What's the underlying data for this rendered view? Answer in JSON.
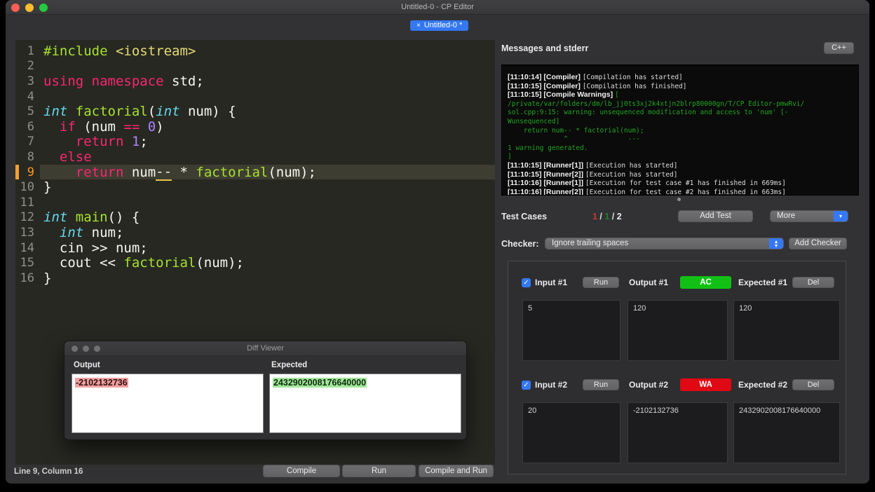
{
  "window": {
    "title": "Untitled-0 - CP Editor"
  },
  "tab": {
    "close_icon": "×",
    "label": "Untitled-0 *"
  },
  "editor": {
    "current_line": 9,
    "status": "Line 9, Column 16",
    "lines": [
      {
        "num": 1,
        "tokens": [
          {
            "t": "#include ",
            "c": "fn"
          },
          {
            "t": "<iostream>",
            "c": "str"
          }
        ]
      },
      {
        "num": 2,
        "tokens": []
      },
      {
        "num": 3,
        "tokens": [
          {
            "t": "using",
            "c": "kw"
          },
          {
            "t": " ",
            "c": "pl"
          },
          {
            "t": "namespace",
            "c": "kw"
          },
          {
            "t": " std;",
            "c": "pl"
          }
        ]
      },
      {
        "num": 4,
        "tokens": []
      },
      {
        "num": 5,
        "tokens": [
          {
            "t": "int",
            "c": "ty"
          },
          {
            "t": " ",
            "c": "pl"
          },
          {
            "t": "factorial",
            "c": "fn"
          },
          {
            "t": "(",
            "c": "pl"
          },
          {
            "t": "int",
            "c": "ty"
          },
          {
            "t": " num) {",
            "c": "pl"
          }
        ]
      },
      {
        "num": 6,
        "tokens": [
          {
            "t": "  ",
            "c": "pl"
          },
          {
            "t": "if",
            "c": "kw"
          },
          {
            "t": " (num ",
            "c": "pl"
          },
          {
            "t": "==",
            "c": "kw"
          },
          {
            "t": " ",
            "c": "pl"
          },
          {
            "t": "0",
            "c": "num"
          },
          {
            "t": ")",
            "c": "pl"
          }
        ]
      },
      {
        "num": 7,
        "tokens": [
          {
            "t": "    ",
            "c": "pl"
          },
          {
            "t": "return",
            "c": "kw"
          },
          {
            "t": " ",
            "c": "pl"
          },
          {
            "t": "1",
            "c": "num"
          },
          {
            "t": ";",
            "c": "pl"
          }
        ]
      },
      {
        "num": 8,
        "tokens": [
          {
            "t": "  ",
            "c": "pl"
          },
          {
            "t": "else",
            "c": "kw"
          }
        ]
      },
      {
        "num": 9,
        "tokens": [
          {
            "t": "    ",
            "c": "pl"
          },
          {
            "t": "return",
            "c": "kw"
          },
          {
            "t": " num",
            "c": "pl"
          },
          {
            "t": "--",
            "c": "ul"
          },
          {
            "t": " * ",
            "c": "pl"
          },
          {
            "t": "factorial",
            "c": "fn"
          },
          {
            "t": "(num);",
            "c": "pl"
          }
        ]
      },
      {
        "num": 10,
        "tokens": [
          {
            "t": "}",
            "c": "pl"
          }
        ]
      },
      {
        "num": 11,
        "tokens": []
      },
      {
        "num": 12,
        "tokens": [
          {
            "t": "int",
            "c": "ty"
          },
          {
            "t": " ",
            "c": "pl"
          },
          {
            "t": "main",
            "c": "fn"
          },
          {
            "t": "() {",
            "c": "pl"
          }
        ]
      },
      {
        "num": 13,
        "tokens": [
          {
            "t": "  ",
            "c": "pl"
          },
          {
            "t": "int",
            "c": "ty"
          },
          {
            "t": " num;",
            "c": "pl"
          }
        ]
      },
      {
        "num": 14,
        "tokens": [
          {
            "t": "  cin >> num;",
            "c": "pl"
          }
        ]
      },
      {
        "num": 15,
        "tokens": [
          {
            "t": "  cout << ",
            "c": "pl"
          },
          {
            "t": "factorial",
            "c": "fn"
          },
          {
            "t": "(num);",
            "c": "pl"
          }
        ]
      },
      {
        "num": 16,
        "tokens": [
          {
            "t": "}",
            "c": "pl"
          }
        ]
      }
    ]
  },
  "actions": {
    "compile": "Compile",
    "run": "Run",
    "compile_and_run": "Compile and Run"
  },
  "messages": {
    "header": "Messages and stderr",
    "language_button": "C++",
    "log": [
      [
        {
          "t": "[11:10:14] [Compiler] ",
          "s": "label"
        },
        {
          "t": "[Compilation has started]",
          "s": "mono"
        }
      ],
      [
        {
          "t": "[11:10:15] [Compiler] ",
          "s": "label"
        },
        {
          "t": "[Compilation has finished]",
          "s": "mono"
        }
      ],
      [
        {
          "t": "[11:10:15] [Compile Warnings] ",
          "s": "label"
        },
        {
          "t": "[",
          "s": "green"
        }
      ],
      [
        {
          "t": "/private/var/folders/dm/lb_jj0ts3xj2k4xtjn2blrp80000gn/T/CP Editor-pmwRvi/",
          "s": "green"
        }
      ],
      [
        {
          "t": "sol.cpp:9:15: warning: unsequenced modification and access to 'num' [-",
          "s": "green"
        }
      ],
      [
        {
          "t": "Wunsequenced]",
          "s": "green"
        }
      ],
      [
        {
          "t": "    return num-- * factorial(num);",
          "s": "green"
        }
      ],
      [
        {
          "t": "              ^               ---",
          "s": "green"
        }
      ],
      [
        {
          "t": "1 warning generated.",
          "s": "green"
        }
      ],
      [
        {
          "t": "]",
          "s": "green"
        }
      ],
      [
        {
          "t": "[11:10:15] [Runner[1]] ",
          "s": "label"
        },
        {
          "t": "[Execution has started]",
          "s": "mono"
        }
      ],
      [
        {
          "t": "[11:10:15] [Runner[2]] ",
          "s": "label"
        },
        {
          "t": "[Execution has started]",
          "s": "mono"
        }
      ],
      [
        {
          "t": "[11:10:16] [Runner[1]] ",
          "s": "label"
        },
        {
          "t": "[Execution for test case #1 has finished in 669ms]",
          "s": "mono"
        }
      ],
      [
        {
          "t": "[11:10:16] [Runner[2]] ",
          "s": "label"
        },
        {
          "t": "[Execution for test case #2 has finished in 663ms]",
          "s": "mono"
        }
      ]
    ]
  },
  "test_cases_bar": {
    "label": "Test Cases",
    "counts": [
      {
        "t": "1",
        "c": "#c23a33"
      },
      {
        "t": " / ",
        "c": "#dcdcdc"
      },
      {
        "t": "1",
        "c": "#1f7d2c"
      },
      {
        "t": " / ",
        "c": "#dcdcdc"
      },
      {
        "t": "2",
        "c": "#ededed"
      }
    ],
    "add_test": "Add Test",
    "more": "More"
  },
  "checker": {
    "label": "Checker:",
    "selected": "Ignore trailing spaces",
    "add_checker": "Add Checker"
  },
  "test_cases": [
    {
      "input_label": "Input #1",
      "run": "Run",
      "output_label": "Output #1",
      "verdict": "AC",
      "verdict_color": "#12c015",
      "expected_label": "Expected #1",
      "del": "Del",
      "checked": true,
      "input": "5",
      "output": "120",
      "expected": "120"
    },
    {
      "input_label": "Input #2",
      "run": "Run",
      "output_label": "Output #2",
      "verdict": "WA",
      "verdict_color": "#e00813",
      "expected_label": "Expected #2",
      "del": "Del",
      "checked": true,
      "input": "20",
      "output": "-2102132736",
      "expected": "2432902008176640000"
    }
  ],
  "diff_viewer": {
    "title": "Diff Viewer",
    "output_label": "Output",
    "expected_label": "Expected",
    "output_value": "-2102132736",
    "expected_value": "2432902008176640000"
  },
  "colors": {
    "accent_blue": "#3478f6",
    "ac_green": "#12c015",
    "wa_red": "#e00813",
    "warning_green": "#21a421"
  }
}
